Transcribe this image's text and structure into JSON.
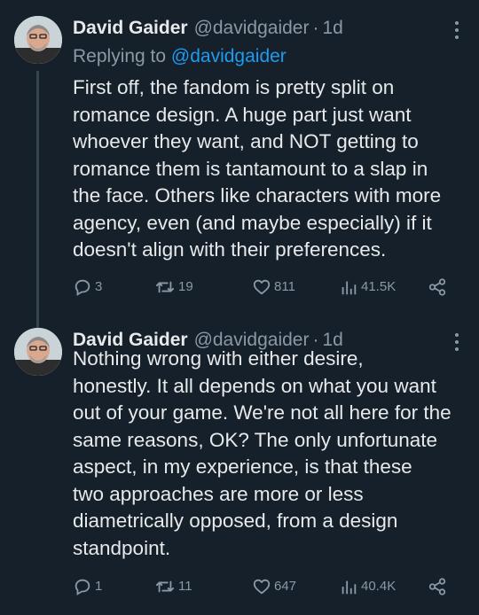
{
  "tweets": [
    {
      "author_name": "David Gaider",
      "handle": "@davidgaider",
      "separator": "·",
      "time": "1d",
      "reply_prefix": "Replying to",
      "reply_to": "@davidgaider",
      "text": "First off, the fandom is pretty split on\nromance design. A huge part just want\nwhoever they want, and NOT getting to\nromance them is tantamount to a slap in\nthe face. Others like characters with more\nagency, even (and maybe especially) if it\ndoesn't align with their preferences.",
      "replies": "3",
      "retweets": "19",
      "likes": "811",
      "views": "41.5K"
    },
    {
      "author_name": "David Gaider",
      "handle": "@davidgaider",
      "separator": "·",
      "time": "1d",
      "text": "Nothing wrong with either desire,\nhonestly. It all depends on what you want\nout of your game. We're not all here for the\nsame reasons, OK? The only unfortunate\naspect, in my experience, is that these\ntwo approaches are more or less\ndiametrically opposed, from a design\nstandpoint.",
      "replies": "1",
      "retweets": "11",
      "likes": "647",
      "views": "40.4K"
    }
  ],
  "icons": {
    "reply": "reply-icon",
    "retweet": "retweet-icon",
    "like": "heart-icon",
    "views": "views-chart-icon",
    "share": "share-icon",
    "more": "more-options-icon"
  },
  "colors": {
    "background": "#15202b",
    "text": "#e7e9ea",
    "secondary": "#8b98a5",
    "link": "#1d9bf0"
  }
}
